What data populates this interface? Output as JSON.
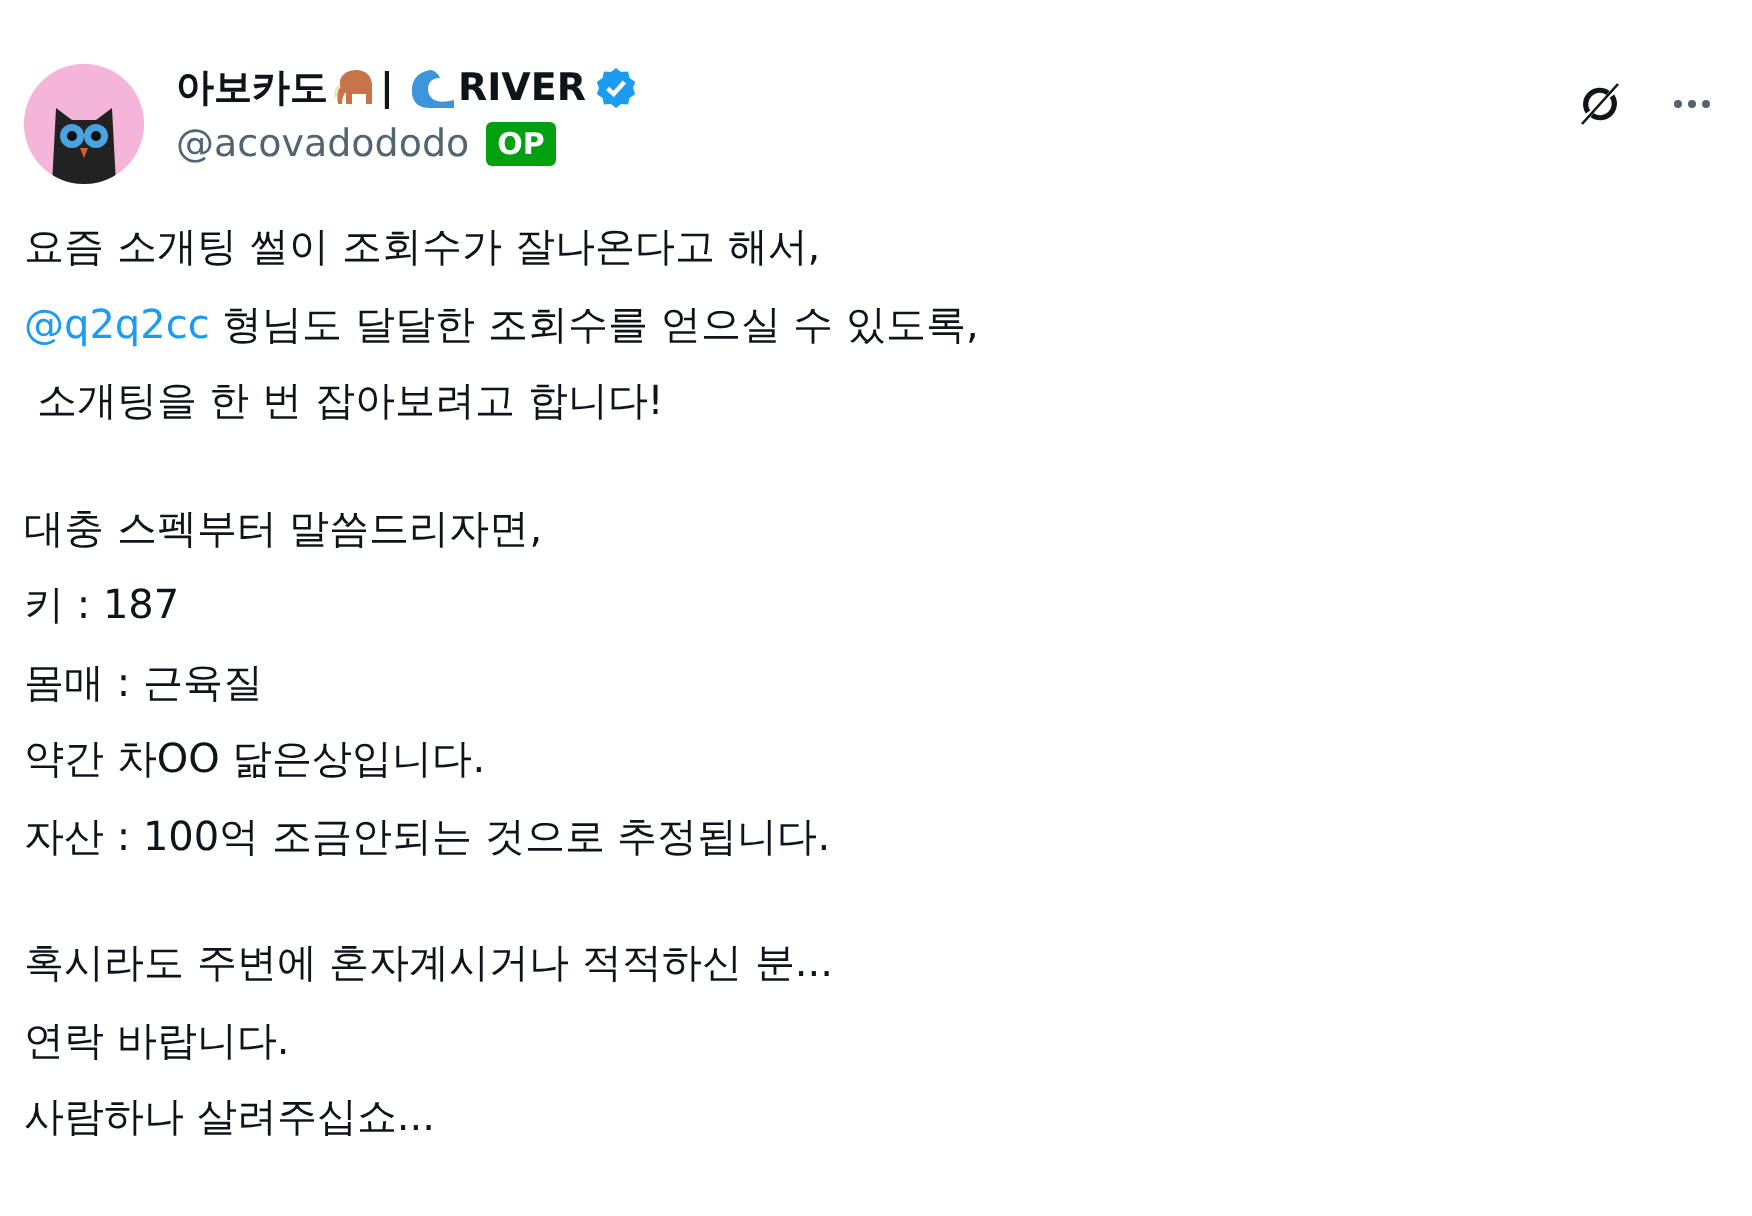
{
  "author": {
    "name_parts": [
      "아보카도",
      "|",
      "RIVER"
    ],
    "verified": true,
    "handle": "@acovadododo",
    "badge": "OP"
  },
  "paragraphs": [
    [
      {
        "text": "요즘 소개팅 썰이 조회수가 잘나온다고 해서,"
      },
      {
        "mention": "@q2q2cc",
        "text": " 형님도 달달한 조회수를 얻으실 수 있도록,"
      },
      {
        "text": " 소개팅을 한 번 잡아보려고 합니다!"
      }
    ],
    [
      {
        "text": "대충 스펙부터 말씀드리자면,"
      },
      {
        "text": "키 : 187"
      },
      {
        "text": "몸매 : 근육질"
      },
      {
        "text": "약간 차OO 닮은상입니다."
      },
      {
        "text": "자산 : 100억 조금안되는 것으로 추정됩니다."
      }
    ],
    [
      {
        "text": "혹시라도 주변에 혼자계시거나 적적하신 분..."
      },
      {
        "text": "연락 바랍니다."
      },
      {
        "text": "사람하나 살려주십쇼..."
      }
    ]
  ]
}
